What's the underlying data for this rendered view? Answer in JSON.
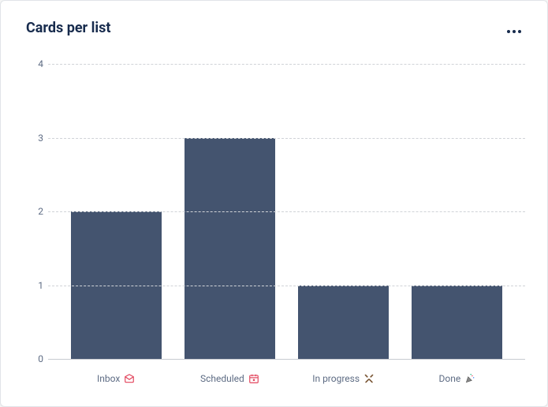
{
  "header": {
    "title": "Cards per list",
    "more_icon": "more-horizontal-icon"
  },
  "chart_data": {
    "type": "bar",
    "title": "Cards per list",
    "xlabel": "",
    "ylabel": "",
    "ylim": [
      0,
      4
    ],
    "yticks": [
      0,
      1,
      2,
      3,
      4
    ],
    "categories": [
      "Inbox",
      "Scheduled",
      "In progress",
      "Done"
    ],
    "category_icons": [
      "inbox-icon",
      "calendar-icon",
      "hammers-icon",
      "tada-icon"
    ],
    "values": [
      2,
      3,
      1,
      1
    ],
    "bar_color": "#44546f"
  }
}
